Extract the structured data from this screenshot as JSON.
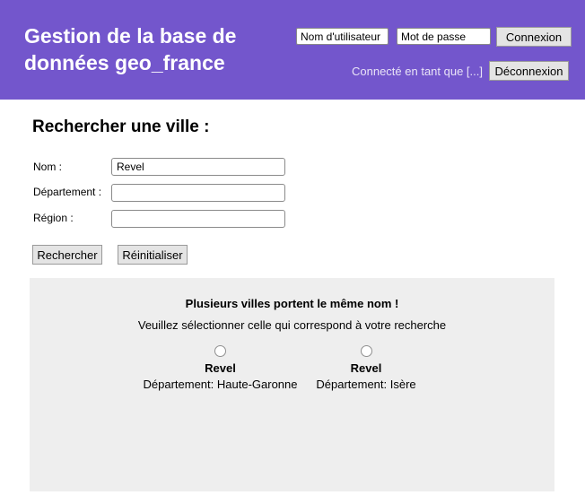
{
  "header": {
    "title": "Gestion de la base de données geo_france",
    "username_placeholder": "Nom d'utilisateur",
    "password_placeholder": "Mot de passe",
    "login_label": "Connexion",
    "status_text": "Connecté en tant que [...]",
    "logout_label": "Déconnexion"
  },
  "search": {
    "title": "Rechercher une ville :",
    "fields": [
      {
        "label": "Nom :",
        "value": "Revel"
      },
      {
        "label": "Département :",
        "value": ""
      },
      {
        "label": "Région :",
        "value": ""
      }
    ],
    "submit_label": "Rechercher",
    "reset_label": "Réinitialiser"
  },
  "results": {
    "heading": "Plusieurs villes portent le même nom !",
    "subheading": "Veuillez sélectionner celle qui correspond à votre recherche",
    "options": [
      {
        "name": "Revel",
        "department": "Département: Haute-Garonne",
        "selected": false
      },
      {
        "name": "Revel",
        "department": "Département: Isère",
        "selected": false
      }
    ]
  },
  "colors": {
    "header_bg": "#7356cc",
    "panel_bg": "#eeeeee"
  }
}
